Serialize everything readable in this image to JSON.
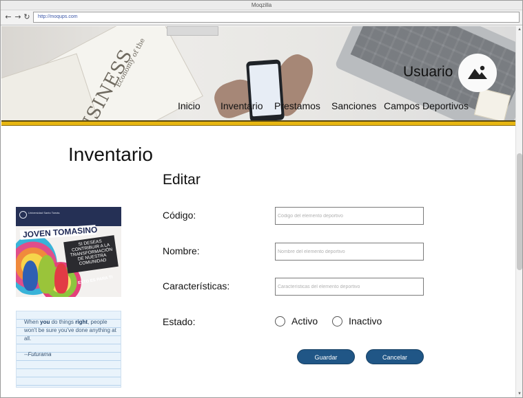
{
  "browser": {
    "window_title": "Moqzilla",
    "url": "http://moqups.com",
    "nav_icons": [
      "back-arrow-icon",
      "forward-arrow-icon",
      "reload-icon"
    ]
  },
  "header": {
    "user_label": "Usuario",
    "avatar_icon": "image-placeholder-icon",
    "nav": [
      {
        "label": "Inicio"
      },
      {
        "label": "Inventario"
      },
      {
        "label": "Prestamos"
      },
      {
        "label": "Sanciones"
      },
      {
        "label": "Campos Deportivos"
      }
    ],
    "accent_color": "#e7b611"
  },
  "page": {
    "title": "Inventario",
    "section_title": "Editar"
  },
  "form": {
    "codigo": {
      "label": "Código:",
      "placeholder": "Código del elemento deportivo",
      "value": ""
    },
    "nombre": {
      "label": "Nombre:",
      "placeholder": "Nombre del elemento deportivo",
      "value": ""
    },
    "caracteristicas": {
      "label": "Características:",
      "placeholder": "Características del elemento deportivo",
      "value": ""
    },
    "estado": {
      "label": "Estado:",
      "options": [
        {
          "label": "Activo",
          "checked": false
        },
        {
          "label": "Inactivo",
          "checked": false
        }
      ]
    },
    "buttons": {
      "save": "Guardar",
      "cancel": "Cancelar",
      "color": "#205686"
    }
  },
  "sidebar": {
    "promo": {
      "university": "Universidad Santo Tomás",
      "headline": "JOVEN TOMASINO",
      "box_text": "SI DESEAS CONTRIBUIR A LA TRANSFORMACIÓN DE NUESTRA COMUNIDAD",
      "small_text": "ESTO ES PARA TI"
    },
    "quote": {
      "text_parts": [
        "When ",
        "you",
        " do things ",
        "right",
        ", people won't be sure you've done anything at all."
      ],
      "author": "--Futurama"
    }
  }
}
